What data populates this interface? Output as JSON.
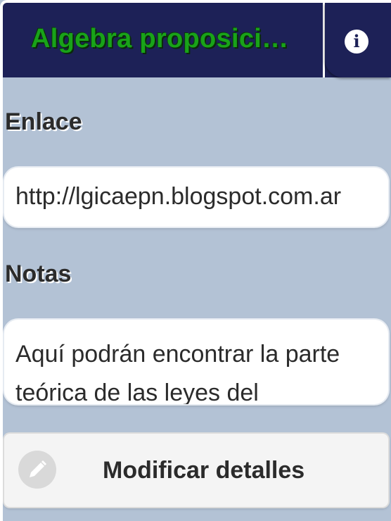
{
  "header": {
    "title": "Algebra proposici…",
    "info_icon": "info-icon"
  },
  "link_section": {
    "label": "Enlace",
    "value": "http://lgicaepn.blogspot.com.ar"
  },
  "notes_section": {
    "label": "Notas",
    "value": "Aquí podrán encontrar la parte teórica de las leyes del"
  },
  "modify_button": {
    "label": "Modificar detalles",
    "icon": "pencil-icon"
  },
  "colors": {
    "header_bg": "#1d2157",
    "title_text": "#19a319",
    "page_bg": "#b3c2d5"
  }
}
